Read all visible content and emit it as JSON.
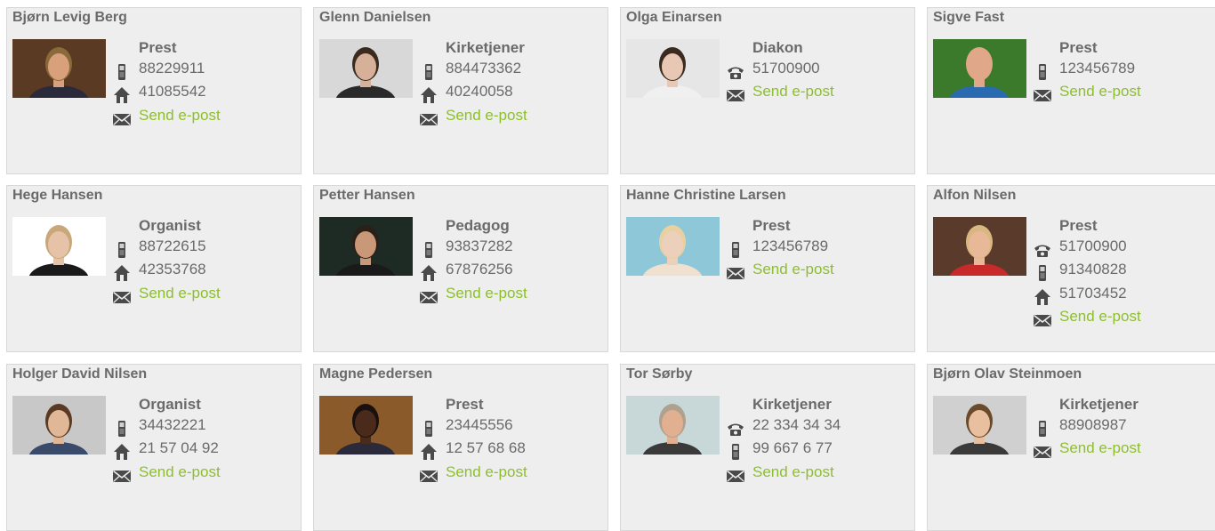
{
  "staff": [
    {
      "name": "Bjørn Levig Berg",
      "role": "Prest",
      "contacts": [
        {
          "type": "mobile",
          "value": "88229911"
        },
        {
          "type": "home",
          "value": "41085542"
        }
      ],
      "email": "Send e-post",
      "photo": {
        "bg": "#5a3a22",
        "skin": "#d9a07c",
        "hair": "#8a6a3a",
        "shirt": "#2a2a3a"
      }
    },
    {
      "name": "Glenn Danielsen",
      "role": "Kirketjener",
      "contacts": [
        {
          "type": "mobile",
          "value": "884473362"
        },
        {
          "type": "home",
          "value": "40240058"
        }
      ],
      "email": "Send e-post",
      "photo": {
        "bg": "#d8d8d8",
        "skin": "#d6b098",
        "hair": "#3b2a1e",
        "shirt": "#2a2a2a"
      }
    },
    {
      "name": "Olga Einarsen",
      "role": "Diakon",
      "contacts": [
        {
          "type": "phone",
          "value": "51700900"
        }
      ],
      "email": "Send e-post",
      "photo": {
        "bg": "#e6e6e6",
        "skin": "#e8c8b4",
        "hair": "#3a2a20",
        "shirt": "#f0f0f0"
      }
    },
    {
      "name": "Sigve Fast",
      "role": "Prest",
      "contacts": [
        {
          "type": "mobile",
          "value": "123456789"
        }
      ],
      "email": "Send e-post",
      "photo": {
        "bg": "#3b7a2a",
        "skin": "#e0a888",
        "hair": "#e0a888",
        "shirt": "#2a6ab0"
      }
    },
    {
      "name": "Hege Hansen",
      "role": "Organist",
      "contacts": [
        {
          "type": "mobile",
          "value": "88722615"
        },
        {
          "type": "home",
          "value": "42353768"
        }
      ],
      "email": "Send e-post",
      "photo": {
        "bg": "#ffffff",
        "skin": "#e6c2a8",
        "hair": "#c8a878",
        "shirt": "#1a1a1a"
      }
    },
    {
      "name": "Petter Hansen",
      "role": "Pedagog",
      "contacts": [
        {
          "type": "mobile",
          "value": "93837282"
        },
        {
          "type": "home",
          "value": "67876256"
        }
      ],
      "email": "Send e-post",
      "photo": {
        "bg": "#1e2a24",
        "skin": "#c89878",
        "hair": "#2a2018",
        "shirt": "#1a1a1a"
      }
    },
    {
      "name": "Hanne Christine Larsen",
      "role": "Prest",
      "contacts": [
        {
          "type": "mobile",
          "value": "123456789"
        }
      ],
      "email": "Send e-post",
      "photo": {
        "bg": "#8ec8d8",
        "skin": "#ecd0bc",
        "hair": "#e8d0a0",
        "shirt": "#f0e0d0"
      }
    },
    {
      "name": "Alfon Nilsen",
      "role": "Prest",
      "contacts": [
        {
          "type": "phone",
          "value": "51700900"
        },
        {
          "type": "mobile",
          "value": "91340828"
        },
        {
          "type": "home",
          "value": "51703452"
        }
      ],
      "email": "Send e-post",
      "photo": {
        "bg": "#5a3a2a",
        "skin": "#e8b898",
        "hair": "#d8b880",
        "shirt": "#c82a2a"
      }
    },
    {
      "name": "Holger David Nilsen",
      "role": "Organist",
      "contacts": [
        {
          "type": "mobile",
          "value": "34432221"
        },
        {
          "type": "home",
          "value": "21 57 04 92"
        }
      ],
      "email": "Send e-post",
      "photo": {
        "bg": "#c8c8c8",
        "skin": "#e0b898",
        "hair": "#5a3a22",
        "shirt": "#3a4a6a"
      }
    },
    {
      "name": "Magne Pedersen",
      "role": "Prest",
      "contacts": [
        {
          "type": "mobile",
          "value": "23445556"
        },
        {
          "type": "home",
          "value": "12 57 68 68"
        }
      ],
      "email": "Send e-post",
      "photo": {
        "bg": "#8a5a2a",
        "skin": "#4a2a1a",
        "hair": "#1a1010",
        "shirt": "#2a2a3a"
      }
    },
    {
      "name": "Tor Sørby",
      "role": "Kirketjener",
      "contacts": [
        {
          "type": "phone",
          "value": "22 334 34 34"
        },
        {
          "type": "mobile",
          "value": "99 667 6 77"
        }
      ],
      "email": "Send e-post",
      "photo": {
        "bg": "#c8d8d8",
        "skin": "#e0b090",
        "hair": "#b0a090",
        "shirt": "#3a3a3a"
      }
    },
    {
      "name": "Bjørn Olav Steinmoen",
      "role": "Kirketjener",
      "contacts": [
        {
          "type": "mobile",
          "value": "88908987"
        }
      ],
      "email": "Send e-post",
      "photo": {
        "bg": "#d0d0d0",
        "skin": "#e8c0a0",
        "hair": "#6a4a2a",
        "shirt": "#3a3a3a"
      }
    }
  ],
  "icons": {
    "mobile": "mobile-phone-icon",
    "home": "home-icon",
    "phone": "telephone-icon",
    "email": "envelope-icon"
  },
  "colors": {
    "email_link": "#8dbf2d",
    "text": "#6a6a6a",
    "card_bg": "#efeeef"
  }
}
